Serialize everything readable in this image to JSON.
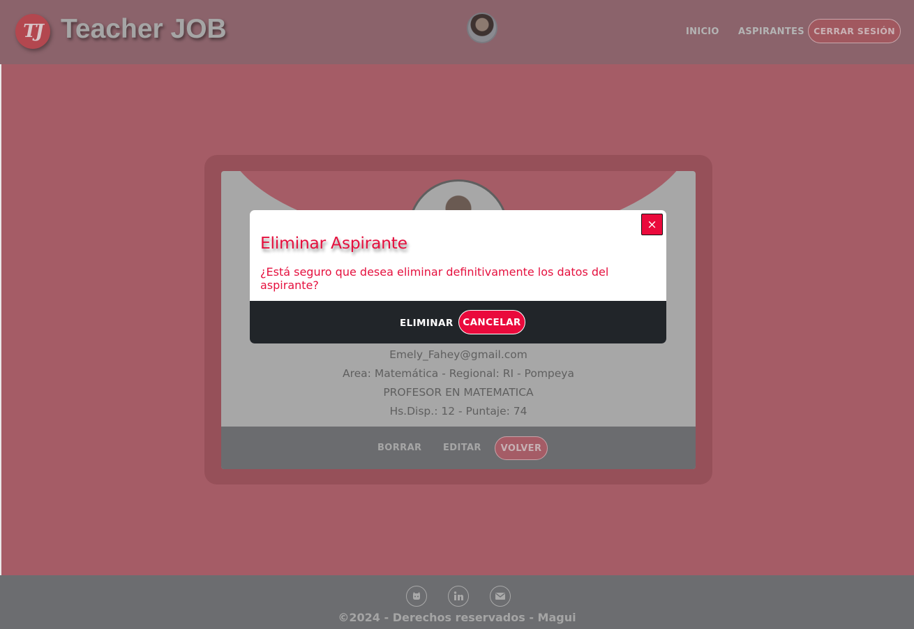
{
  "navbar": {
    "logo_text": "TJ",
    "brand": "Teacher JOB",
    "links": [
      "INICIO",
      "ASPIRANTES"
    ],
    "logout_label": "CERRAR SESIÓN"
  },
  "card": {
    "email": "Emely_Fahey@gmail.com",
    "area_line": "Area: Matemática - Regional: RI - Pompeya",
    "title_line": "PROFESOR EN MATEMATICA",
    "hours_line": "Hs.Disp.: 12 - Puntaje: 74",
    "footer": {
      "delete_label": "BORRAR",
      "edit_label": "EDITAR",
      "back_label": "VOLVER"
    }
  },
  "modal": {
    "close_label": "×",
    "title": "Eliminar Aspirante",
    "body": "¿Está seguro que desea eliminar definitivamente los datos del aspirante?",
    "confirm_label": "ELIMINAR",
    "cancel_label": "CANCELAR"
  },
  "footer": {
    "icons": [
      "github-icon",
      "linkedin-icon",
      "mail-icon"
    ],
    "copyright": "©2024 - Derechos reservados - Magui"
  },
  "colors": {
    "accent": "#ea0a3c",
    "modal_footer": "#212529",
    "backdrop_page": "#a55c66"
  }
}
